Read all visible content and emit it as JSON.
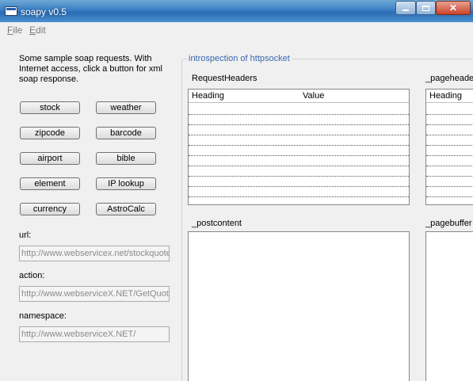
{
  "window": {
    "title": "soapy v0.5"
  },
  "menu": {
    "file": "File",
    "edit": "Edit"
  },
  "description": "Some sample soap requests.  With Internet access, click a button for xml soap response.",
  "buttons": [
    "stock",
    "weather",
    "zipcode",
    "barcode",
    "airport",
    "bible",
    "element",
    "IP lookup",
    "currency",
    "AstroCalc"
  ],
  "url": {
    "label": "url:",
    "value": "http://www.webservicex.net/stockquote.asmx"
  },
  "action": {
    "label": "action:",
    "value": "http://www.webserviceX.NET/GetQuote"
  },
  "namespace": {
    "label": "namespace:",
    "value": "http://www.webserviceX.NET/"
  },
  "introspection": {
    "legend": "introspection of httpsocket",
    "request_headers": {
      "title": "RequestHeaders",
      "col_heading": "Heading",
      "col_value": "Value"
    },
    "page_headers": {
      "title": "_pageheaders",
      "col_heading": "Heading"
    },
    "postcontent": {
      "title": "_postcontent"
    },
    "pagebuffer": {
      "title": "_pagebuffer"
    }
  }
}
